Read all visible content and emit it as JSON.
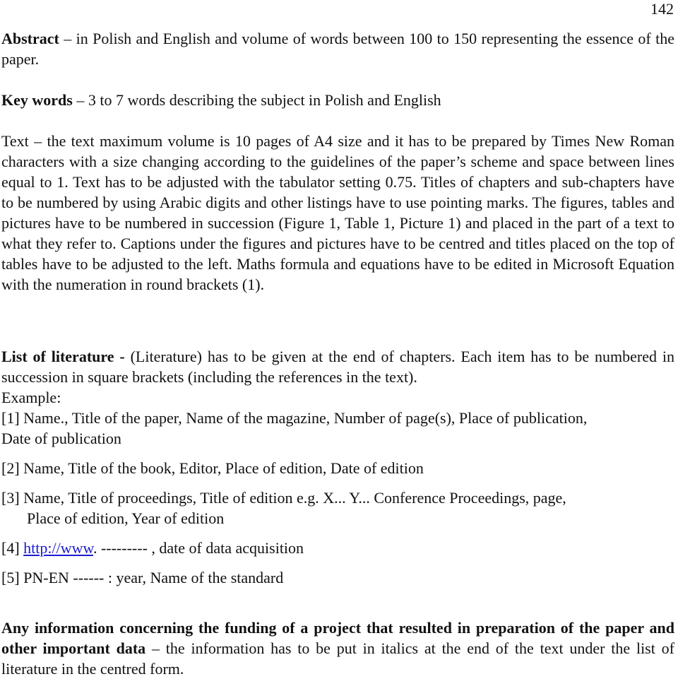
{
  "page": {
    "number": "142"
  },
  "abstract": {
    "term": "Abstract",
    "text": " – in Polish and English and volume of words between 100 to 150 representing the essence of the paper."
  },
  "keywords": {
    "term": "Key words",
    "text": " – 3 to 7 words describing the subject in Polish and English"
  },
  "text_section": {
    "body": "Text – the text maximum volume is 10 pages of A4 size and it has to be prepared by Times New Roman characters with a size changing according to the guidelines of the paper’s scheme and space between lines equal to 1. Text has to be adjusted with the tabulator setting 0.75. Titles of chapters and sub-chapters have to be numbered by using Arabic digits and other listings have to use pointing marks. The figures, tables and pictures have to be numbered in succession (Figure 1, Table 1, Picture 1) and placed in the part of a text to what they refer to. Captions under the figures and pictures have to be centred and titles placed on the top of tables have to be adjusted to the left. Maths formula and equations have to be edited in Microsoft Equation with the numeration in round brackets (1)."
  },
  "literature": {
    "term": "List of literature -",
    "text": " (Literature) has to be given at the end of chapters. Each item has to be numbered in succession in square brackets (including the references in the text).",
    "example_label": "Example:",
    "references": [
      {
        "line1": "[1] Name., Title of the paper, Name of the magazine, Number of page(s), Place of publication,",
        "line2": "Date of publication"
      },
      {
        "line1": "[2] Name, Title of the book, Editor, Place of edition, Date of edition"
      },
      {
        "line1": "[3] Name, Title of proceedings, Title of edition e.g. X... Y... Conference Proceedings, page,",
        "line2": "Place of edition, Year of edition"
      },
      {
        "prefix": "[4] ",
        "link": "http://www",
        "suffix": ". --------- , date of data acquisition"
      },
      {
        "line1": "[5] PN-EN ------ : year, Name of the standard"
      }
    ]
  },
  "funding": {
    "term": "Any information concerning the funding of a project that resulted in preparation of the paper and other important data",
    "text": " – the information has to be put in italics at the end of the text under the list of literature in the centred form."
  },
  "colors": {
    "link": "#1a1ad0",
    "text": "#111111"
  }
}
